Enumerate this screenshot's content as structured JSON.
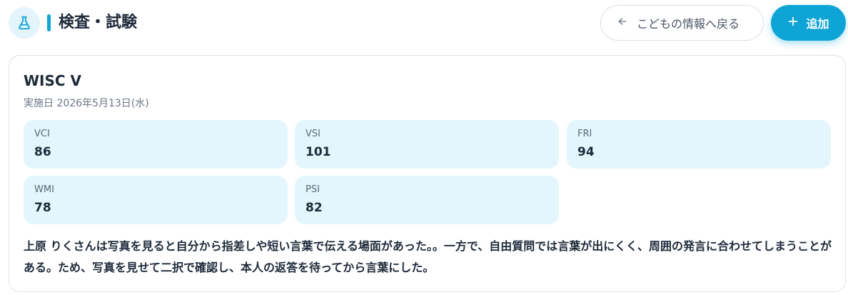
{
  "header": {
    "title": "検査・試験",
    "icon": "flask-icon",
    "accent_color": "#0ea5d6",
    "back_label": "こどもの情報へ戻る",
    "add_label": "追加"
  },
  "test": {
    "name": "WISC V",
    "date": "実施日 2026年5月13日(水)",
    "scores": [
      {
        "label": "VCI",
        "value": "86"
      },
      {
        "label": "VSI",
        "value": "101"
      },
      {
        "label": "FRI",
        "value": "94"
      },
      {
        "label": "WMI",
        "value": "78"
      },
      {
        "label": "PSI",
        "value": "82"
      }
    ],
    "note": "上原 りくさんは写真を見ると自分から指差しや短い言葉で伝える場面があった。。一方で、自由質問では言葉が出にくく、周囲の発言に合わせてしまうことがある。ため、写真を見せて二択で確認し、本人の返答を待ってから言葉にした。"
  }
}
